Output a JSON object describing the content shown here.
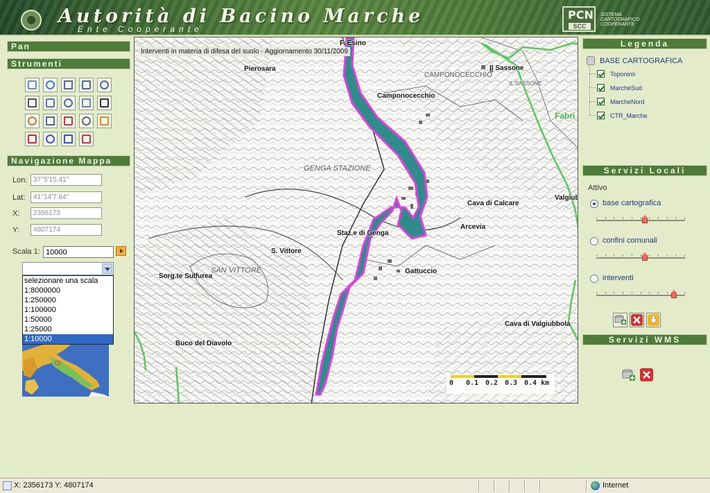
{
  "banner": {
    "title": "Autorità di Bacino Marche",
    "subtitle": "Ente Cooperante",
    "logo_main": "PCN",
    "logo_sub": "SCC",
    "logo_text_1": "SISTEMA",
    "logo_text_2": "CARTOGRAFICO",
    "logo_text_3": "COOPERANTE"
  },
  "left": {
    "pan_header": "Pan",
    "tools_header": "Strumenti",
    "nav_header": "Navigazione Mappa",
    "lon_label": "Lon:",
    "lon_value": "37°5'15.41\"",
    "lat_label": "Lat:",
    "lat_value": "41°14'7.64\"",
    "x_label": "X:",
    "x_value": "2356173",
    "y_label": "Y:",
    "y_value": "4807174",
    "scala_label": "Scala 1:",
    "scala_value": "10000",
    "scale_options": [
      "selezionare una scala",
      "1:8000000",
      "1:250000",
      "1:100000",
      "1:50000",
      "1:25000",
      "1:10000"
    ],
    "tools": [
      "layer-list-icon",
      "globe-icon",
      "zoom-box-icon",
      "zoom-in-icon",
      "zoom-out-icon",
      "xy-coordinate-icon",
      "identify-icon",
      "query-icon",
      "select-area-icon",
      "binoculars-icon",
      "measure-icon",
      "select-box-icon",
      "eraser-icon",
      "print-icon",
      "back-arrow-icon",
      "resize-icon",
      "next-extent-icon",
      "previous-extent-icon",
      "pdf-icon"
    ]
  },
  "map": {
    "title": "Interventi in materia di difesa del suolo - Aggiornamento 30/11/2009",
    "places": {
      "esino": "F. Esino",
      "pierosara": "Pierosara",
      "camponocecchio_bold": "Camponocecchio",
      "camponocecchio_map": "CAMPONOCECCHIO",
      "sassone": "Il Sassone",
      "sassone_map": "IL SASSONE",
      "fabri": "Fabri",
      "genga_stazione": "GENGA STAZIONE",
      "cava_calcare": "Cava di Calcare",
      "valgiubb": "Valgiub",
      "arcevia": "Arcevia",
      "staz_genga": "Staz.e di Genga",
      "s_vittore": "S. Vittore",
      "san_vittore_map": "SAN VITTORE",
      "gattuccio": "Gattuccio",
      "sorgente_sulfurea": "Sorg.te Sulfurea",
      "cava_valgiubbola": "Cava di Valgiubbola",
      "buco_diavolo": "Buco del Diavolo"
    },
    "scale_ticks": [
      "0",
      "0.1",
      "0.2",
      "0.3",
      "0.4 km"
    ]
  },
  "right": {
    "legend_header": "Legenda",
    "base_label": "BASE CARTOGRAFICA",
    "layers": [
      "Toponimi",
      "MarcheSud",
      "MarcheNord",
      "CTR_Marche"
    ],
    "local_header": "Servizi Locali",
    "attivo_label": "Attivo",
    "services": [
      {
        "label": "base cartografica",
        "checked": true,
        "opacity": 0.55
      },
      {
        "label": "confini comunali",
        "checked": false,
        "opacity": 0.55
      },
      {
        "label": "interventi",
        "checked": false,
        "opacity": 0.9
      }
    ],
    "wms_header": "Servizi WMS"
  },
  "status": {
    "text": "X: 2356173  Y: 4807174",
    "zone": "Internet"
  },
  "colors": {
    "panel_bg": "#e4ebcb",
    "header_green": "#4e7a3a",
    "river_fill": "#2f8c8a",
    "river_outline": "#e040e0",
    "boundary_green": "#5ac85a"
  }
}
